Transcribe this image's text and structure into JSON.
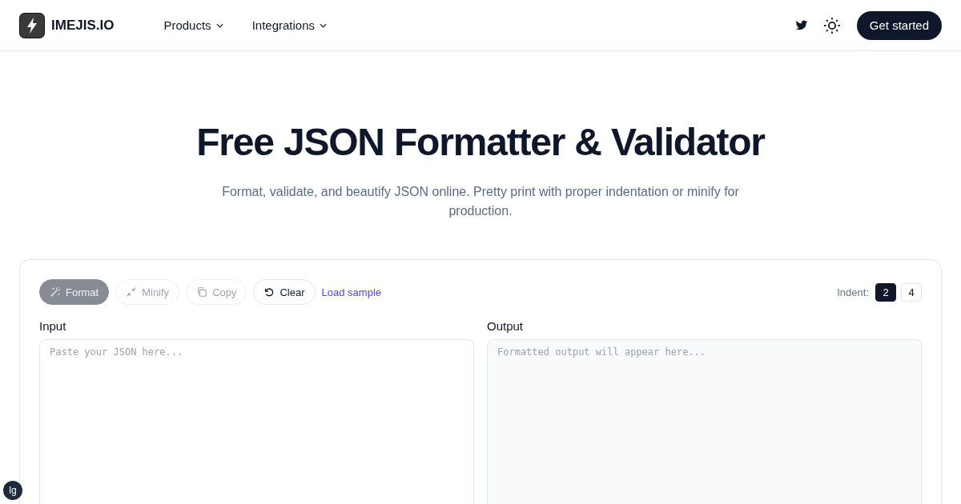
{
  "header": {
    "brand": "IMEJIS.IO",
    "nav": [
      {
        "label": "Products"
      },
      {
        "label": "Integrations"
      }
    ],
    "cta": "Get started"
  },
  "hero": {
    "title": "Free JSON Formatter & Validator",
    "subtitle": "Format, validate, and beautify JSON online. Pretty print with proper indentation or minify for production."
  },
  "toolbar": {
    "actions": [
      {
        "label": "Format",
        "kind": "primary",
        "disabled": true
      },
      {
        "label": "Minify",
        "kind": "secondary",
        "disabled": true
      },
      {
        "label": "Copy",
        "kind": "secondary",
        "disabled": true
      },
      {
        "label": "Clear",
        "kind": "secondary",
        "disabled": false
      }
    ],
    "link": "Load sample",
    "indent_label": "Indent:",
    "indent_options": [
      {
        "label": "2",
        "selected": true
      },
      {
        "label": "4",
        "selected": false
      }
    ]
  },
  "panes": [
    {
      "label": "Input",
      "placeholder": "Paste your JSON here..."
    },
    {
      "label": "Output",
      "placeholder": "Formatted output will appear here..."
    }
  ],
  "badge": "lg"
}
